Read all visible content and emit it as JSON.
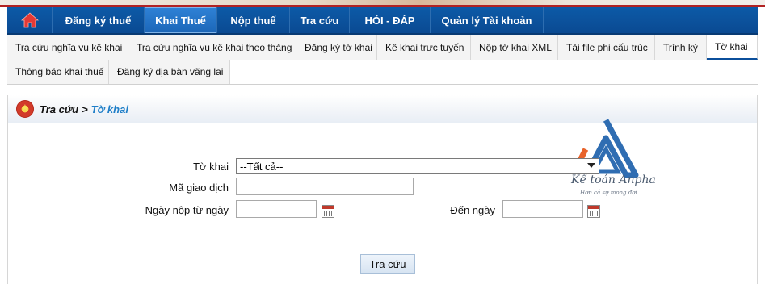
{
  "nav": {
    "items": [
      {
        "label": "Đăng ký thuế",
        "active": false
      },
      {
        "label": "Khai Thuế",
        "active": true
      },
      {
        "label": "Nộp thuế",
        "active": false
      },
      {
        "label": "Tra cứu",
        "active": false
      },
      {
        "label": "HỎI - ĐÁP",
        "active": false
      },
      {
        "label": "Quản lý Tài khoản",
        "active": false
      }
    ]
  },
  "subtabs": {
    "row1": [
      {
        "label": "Tra cứu nghĩa vụ kê khai"
      },
      {
        "label": "Tra cứu nghĩa vụ kê khai theo tháng"
      },
      {
        "label": "Đăng ký tờ khai"
      },
      {
        "label": "Kê khai trực tuyến"
      },
      {
        "label": "Nộp tờ khai XML"
      },
      {
        "label": "Tải file phi cấu trúc"
      },
      {
        "label": "Trình ký"
      },
      {
        "label": "Tờ khai",
        "active": true
      }
    ],
    "row2": [
      {
        "label": "Thông báo khai thuế"
      },
      {
        "label": "Đăng ký địa bàn vãng lai"
      }
    ]
  },
  "breadcrumb": {
    "root": "Tra cứu",
    "separator": ">",
    "current": "Tờ khai"
  },
  "form": {
    "to_khai_label": "Tờ khai",
    "to_khai_value": "--Tất cả--",
    "ma_giao_dich_label": "Mã giao dịch",
    "ngay_nop_label": "Ngày nộp từ ngày",
    "den_ngay_label": "Đến ngày",
    "search_button": "Tra cứu"
  },
  "watermark": {
    "brand": "Kế toán Anpha",
    "slogan": "Hơn cả sự mong đợi"
  },
  "colors": {
    "nav_bg": "#0d5aa7",
    "nav_active": "#2f82d6",
    "breadcrumb_current": "#1f7fc8",
    "logo_orange": "#e8632b",
    "logo_blue": "#2f6db2"
  }
}
